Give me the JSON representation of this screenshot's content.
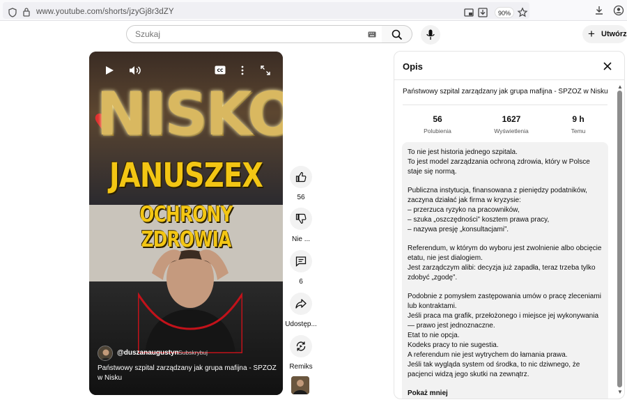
{
  "browser": {
    "url": "www.youtube.com/shorts/jzyGj8r3dZY",
    "zoom": "90%"
  },
  "header": {
    "search_placeholder": "Szukaj",
    "create_label": "Utwórz"
  },
  "video": {
    "overlay_line1": "NISKO",
    "overlay_line2": "JANUSZEX",
    "overlay_line3": "OCHRONY ZDROWIA",
    "channel": "@duszanaugustyn",
    "subscribe": "Subskrybuj",
    "caption": "Państwowy szpital zarządzany jak grupa mafijna - SPZOZ w Nisku"
  },
  "actions": {
    "like_count": "56",
    "dislike_label": "Nie ...",
    "comments_count": "6",
    "share_label": "Udostęp...",
    "remix_label": "Remiks"
  },
  "description": {
    "title": "Opis",
    "video_title": "Państwowy szpital zarządzany jak grupa mafijna - SPZOZ w Nisku",
    "stats": [
      {
        "value": "56",
        "label": "Polubienia"
      },
      {
        "value": "1627",
        "label": "Wyświetlenia"
      },
      {
        "value": "9 h",
        "label": "Temu"
      }
    ],
    "paragraphs": [
      "To nie jest historia jednego szpitala.\nTo jest model zarządzania ochroną zdrowia, który w Polsce staje się normą.",
      "Publiczna instytucja, finansowana z pieniędzy podatników, zaczyna działać jak firma w kryzysie:\n– przerzuca ryzyko na pracowników,\n– szuka „oszczędności” kosztem prawa pracy,\n– nazywa presję „konsultacjami”.",
      "Referendum, w którym do wyboru jest zwolnienie albo obcięcie etatu, nie jest dialogiem.\nJest zarządczym alibi: decyzja już zapadła, teraz trzeba tylko zdobyć „zgodę”.",
      "Podobnie z pomysłem zastępowania umów o pracę zleceniami lub kontraktami.\nJeśli praca ma grafik, przełożonego i miejsce jej wykonywania — prawo jest jednoznaczne.\nEtat to nie opcja.\nKodeks pracy to nie sugestia.\nA referendum nie jest wytrychem do łamania prawa.\nJeśli tak wygląda system od środka, to nic dziwnego, że pacjenci widzą jego skutki na zewnątrz."
    ],
    "show_less": "Pokaż mniej"
  }
}
